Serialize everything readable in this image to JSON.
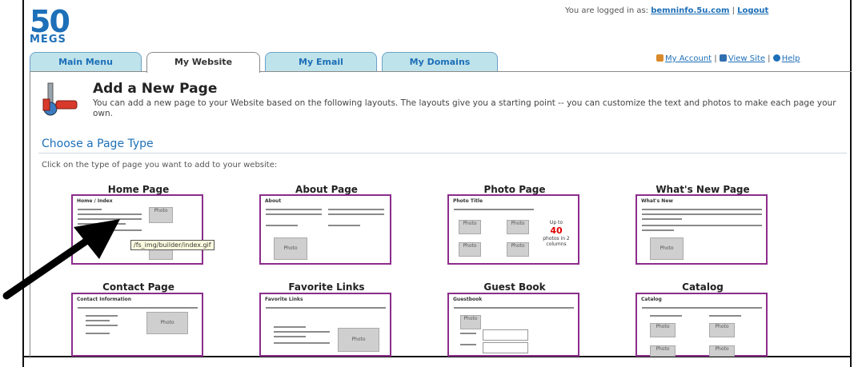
{
  "logo": {
    "number": "50",
    "word": "MEGS"
  },
  "session": {
    "prefix": "You are logged in as:",
    "user": "bemninfo.5u.com",
    "separator": "|",
    "logout": "Logout"
  },
  "tabs": [
    {
      "label": "Main Menu"
    },
    {
      "label": "My Website"
    },
    {
      "label": "My Email"
    },
    {
      "label": "My Domains"
    }
  ],
  "top_links": {
    "account": "My Account",
    "view_site": "View Site",
    "help": "Help"
  },
  "header": {
    "title": "Add a New Page",
    "description": "You can add a new page to your Website based on the following layouts. The layouts give you a starting point -- you can customize the text and photos to make each page your own."
  },
  "section": {
    "title": "Choose a Page Type",
    "instruction": "Click on the type of page you want to add to your website:"
  },
  "page_types": [
    {
      "title": "Home Page",
      "thumb_label": "Home / Index",
      "photo": "Photo"
    },
    {
      "title": "About Page",
      "thumb_label": "About",
      "photo": "Photo"
    },
    {
      "title": "Photo Page",
      "thumb_label": "Photo Title",
      "photo": "Photo",
      "up_to": "Up to",
      "count": "40",
      "photos_in": "photos in 2 columns"
    },
    {
      "title": "What's New Page",
      "thumb_label": "What's New",
      "photo": "Photo"
    },
    {
      "title": "Contact Page",
      "thumb_label": "Contact Information",
      "photo": "Photo"
    },
    {
      "title": "Favorite Links",
      "thumb_label": "Favorite Links",
      "photo": "Photo"
    },
    {
      "title": "Guest Book",
      "thumb_label": "Guestbook",
      "photo": "Photo"
    },
    {
      "title": "Catalog",
      "thumb_label": "Catalog",
      "photo": "Photo"
    }
  ],
  "tooltip": {
    "text": "/fs_img/builder/index.gif"
  },
  "colors": {
    "brand": "#1d6fb8",
    "tab_inactive": "#bfe3ea",
    "thumb_border": "#8c2c8c",
    "count_red": "#e00000"
  },
  "icons": {
    "header": "wrench-icon",
    "account": "user-icon",
    "view_site": "key-icon",
    "help": "help-icon",
    "pointer": "arrow-icon"
  }
}
